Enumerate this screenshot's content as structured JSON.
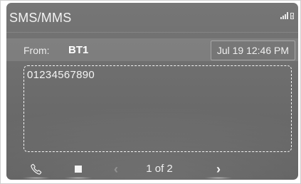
{
  "app": {
    "title": "SMS/MMS"
  },
  "status": {
    "signal_icon": "signal-bars-icon",
    "battery_icon": "battery-icon"
  },
  "message": {
    "from_label": "From:",
    "from_value": "BT1",
    "datetime": "Jul 19 12:46 PM",
    "body": "01234567890"
  },
  "controls": {
    "call_icon": "phone-icon",
    "stop_icon": "stop-icon",
    "prev_icon": "chevron-left-icon",
    "next_icon": "chevron-right-icon",
    "page_indicator": "1 of 2"
  }
}
